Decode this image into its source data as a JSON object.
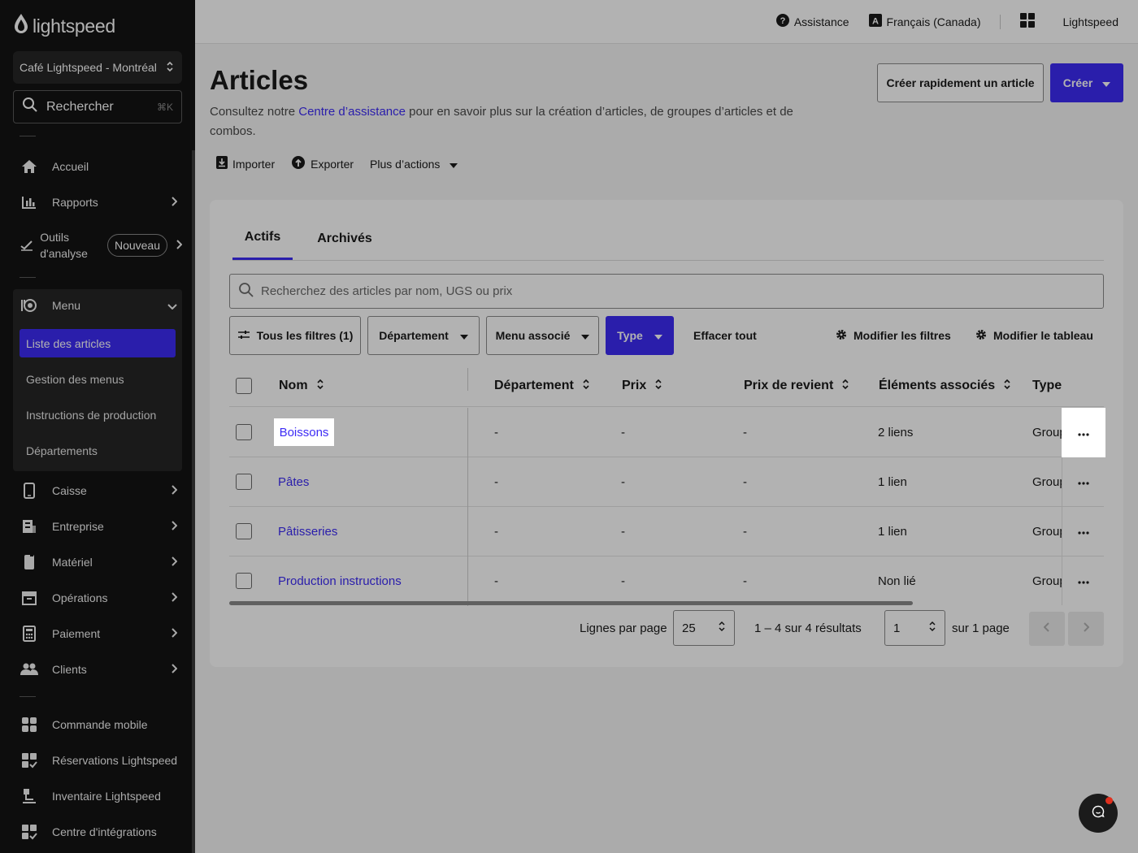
{
  "sidebar": {
    "logo": "lightspeed",
    "location": "Café Lightspeed - Montréal",
    "search_label": "Rechercher",
    "search_shortcut": "⌘K",
    "items": {
      "home": "Accueil",
      "reports": "Rapports",
      "analytics_line1": "Outils",
      "analytics_line2": "d'analyse",
      "analytics_badge": "Nouveau",
      "menu": "Menu",
      "pos": "Caisse",
      "company": "Entreprise",
      "hardware": "Matériel",
      "operations": "Opérations",
      "payment": "Paiement",
      "clients": "Clients",
      "mobile_order": "Commande mobile",
      "reservations": "Réservations Lightspeed",
      "inventory": "Inventaire Lightspeed",
      "integrations": "Centre d'intégrations"
    },
    "menu_sub": {
      "items_list": "Liste des articles",
      "menu_management": "Gestion des menus",
      "production_instructions": "Instructions de production",
      "departments": "Départements"
    }
  },
  "topbar": {
    "help": "Assistance",
    "language": "Français (Canada)",
    "account": "Lightspeed"
  },
  "page": {
    "title": "Articles",
    "desc_before": "Consultez notre ",
    "desc_link": "Centre d’assistance",
    "desc_after": " pour en savoir plus sur la création d’articles, de groupes d’articles et de combos.",
    "quick_create": "Créer rapidement un article",
    "create": "Créer",
    "import": "Importer",
    "export": "Exporter",
    "more_actions": "Plus d’actions"
  },
  "tabs": {
    "active": "Actifs",
    "archived": "Archivés"
  },
  "search": {
    "placeholder": "Recherchez des articles par nom, UGS ou prix"
  },
  "filters": {
    "all": "Tous les filtres (1)",
    "department": "Département",
    "menu": "Menu associé",
    "type": "Type",
    "clear": "Effacer tout",
    "edit_filters": "Modifier les filtres",
    "edit_table": "Modifier le tableau"
  },
  "table": {
    "columns": {
      "name": "Nom",
      "department": "Département",
      "price": "Prix",
      "cost": "Prix de revient",
      "linked": "Éléments associés",
      "type": "Type"
    },
    "rows": [
      {
        "name": "Boissons",
        "department": "-",
        "price": "-",
        "cost": "-",
        "linked": "2 liens",
        "type": "Groupe"
      },
      {
        "name": "Pâtes",
        "department": "-",
        "price": "-",
        "cost": "-",
        "linked": "1 lien",
        "type": "Groupe"
      },
      {
        "name": "Pâtisseries",
        "department": "-",
        "price": "-",
        "cost": "-",
        "linked": "1 lien",
        "type": "Groupe"
      },
      {
        "name": "Production instructions",
        "department": "-",
        "price": "-",
        "cost": "-",
        "linked": "Non lié",
        "type": "Groupe"
      }
    ]
  },
  "pagination": {
    "rows_per_page_label": "Lignes par page",
    "rows_per_page": "25",
    "results": "1 – 4 sur 4 résultats",
    "page": "1",
    "of_pages": "sur 1 page"
  },
  "colors": {
    "accent": "#3d2cf5",
    "sidebar_bg": "#141414",
    "overlay": "rgba(0,0,0,0.3)"
  }
}
